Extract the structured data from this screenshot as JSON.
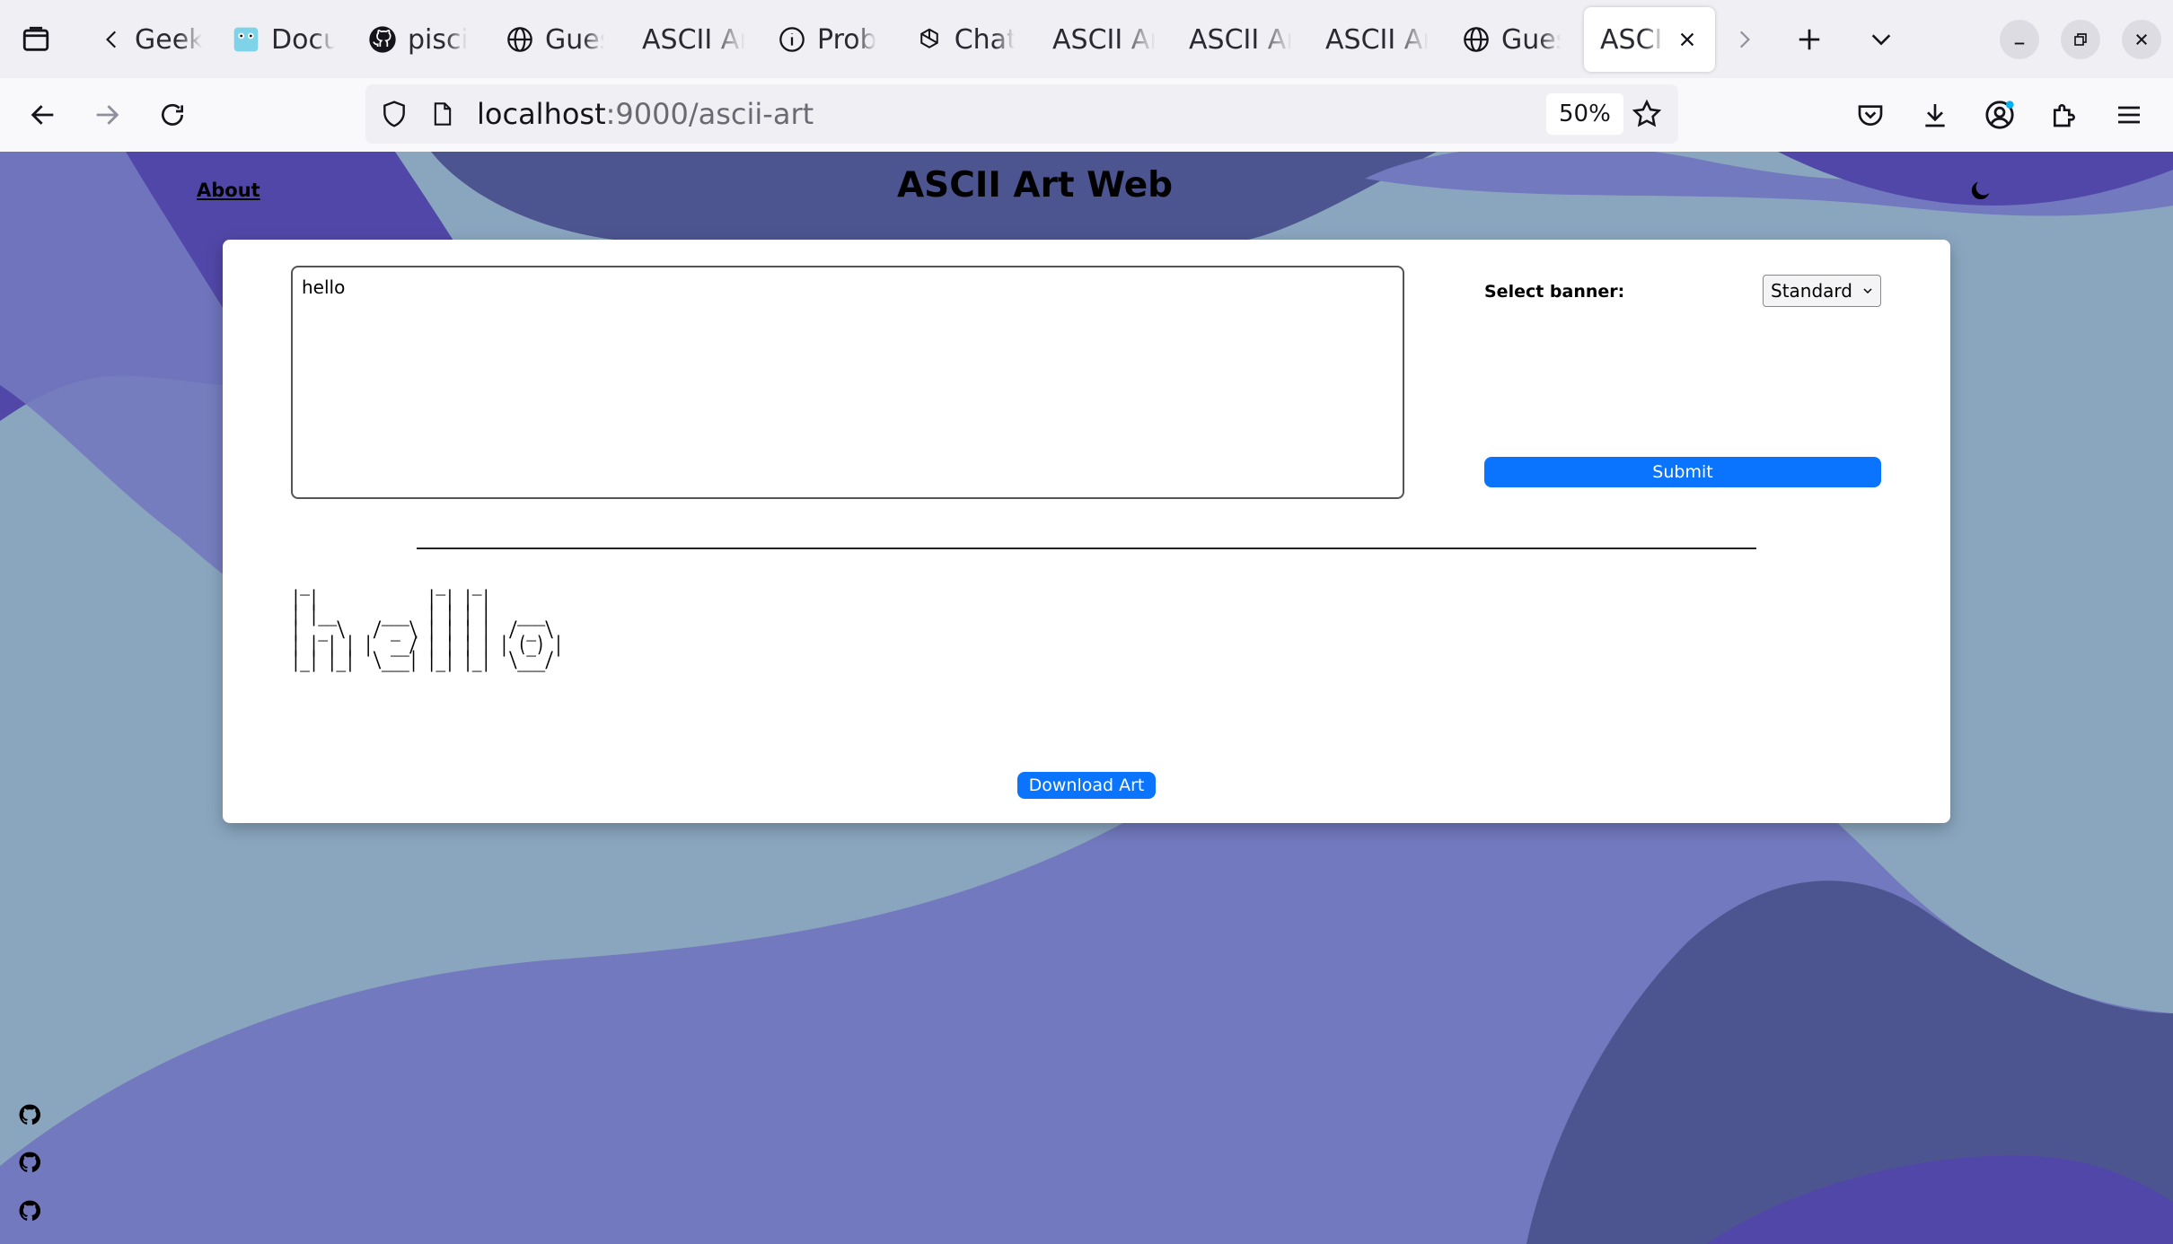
{
  "browser": {
    "tabs": [
      {
        "label": "Geek",
        "icon": "none"
      },
      {
        "label": "Docu",
        "icon": "gopher-icon"
      },
      {
        "label": "pisci",
        "icon": "github-icon"
      },
      {
        "label": "Gues",
        "icon": "globe-icon"
      },
      {
        "label": "ASCII Ar",
        "icon": "none"
      },
      {
        "label": "Prob",
        "icon": "info-icon"
      },
      {
        "label": "Chat",
        "icon": "openai-icon"
      },
      {
        "label": "ASCII Ar",
        "icon": "none"
      },
      {
        "label": "ASCII Ar",
        "icon": "none"
      },
      {
        "label": "ASCII Ar",
        "icon": "none"
      },
      {
        "label": "Gues",
        "icon": "globe-icon"
      }
    ],
    "active_tab": {
      "label": "ASCII"
    },
    "url_host": "localhost",
    "url_path": ":9000/ascii-art",
    "zoom": "50%"
  },
  "page": {
    "about_label": "About",
    "title": "ASCII Art Web",
    "input_value": "hello",
    "banner_label": "Select banner:",
    "banner_selected": "Standard",
    "submit_label": "Submit",
    "ascii_art": " _              _   _          \n| |            | | | |         \n| |__     ___  | | | |   ___   \n|  _ \\   / _ \\ | | | |  / _ \\  \n| | | | |  __/ | | | | | (_) | \n|_| |_|  \\___| |_| |_|  \\___/  \n                               \n                               ",
    "download_label": "Download Art"
  },
  "colors": {
    "accent": "#0a74ff",
    "background": "#8aa6bf",
    "blob_light": "#7279be",
    "blob_dark": "#4d5590",
    "blob_deep": "#5147a8"
  }
}
